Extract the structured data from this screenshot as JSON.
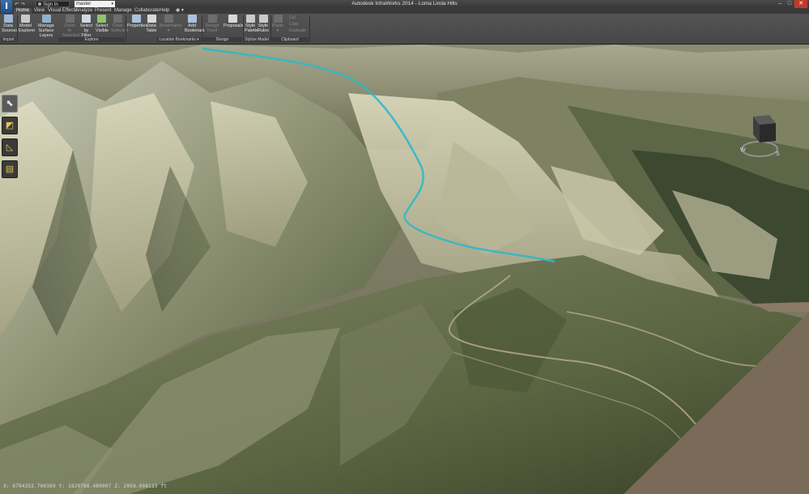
{
  "app": {
    "logo_letter": "I",
    "window_title": "Autodesk InfraWorks 2014 - Loma Linda Hills",
    "signin_label": "Sign In",
    "proposal_value": "master",
    "window_controls": [
      "–",
      "□",
      "✕"
    ]
  },
  "quick_access": {
    "undo_icon": "undo-icon",
    "redo_icon": "redo-icon"
  },
  "tabs": [
    "Home",
    "View",
    "Visual Effects",
    "Analyze",
    "Present",
    "Manage",
    "Collaborate",
    "Help"
  ],
  "tabs_overflow": "◉ ▾",
  "ribbon": {
    "buttons": [
      {
        "id": "data-sources",
        "label": "Data\nSources",
        "icon": "database-icon",
        "color": "#9fb8d6",
        "enabled": true
      },
      {
        "id": "model-explorer",
        "label": "Model\nExplorer",
        "icon": "tree-icon",
        "color": "#c9c9c9",
        "enabled": true
      },
      {
        "id": "manage-surface-layers",
        "label": "Manage\nSurface Layers",
        "icon": "layers-icon",
        "color": "#8fb0d0",
        "enabled": true
      },
      {
        "id": "zoom-to-selected",
        "label": "Zoom to\nSelected",
        "icon": "zoom-icon",
        "color": "#6d6d6d",
        "enabled": false
      },
      {
        "id": "select-by-filter",
        "label": "Select by\nFilter",
        "icon": "filter-icon",
        "color": "#cfd8e2",
        "enabled": true
      },
      {
        "id": "select-visible",
        "label": "Select\nVisible",
        "icon": "select-icon",
        "color": "#8cc46a",
        "enabled": true
      },
      {
        "id": "clear-selected",
        "label": "Clear\nSelected",
        "icon": "clear-icon",
        "color": "#6d6d6d",
        "enabled": false
      },
      {
        "id": "properties",
        "label": "Properties",
        "icon": "properties-icon",
        "color": "#a9c2dd",
        "enabled": true
      },
      {
        "id": "data-table",
        "label": "Data\nTable",
        "icon": "table-icon",
        "color": "#d8d8d8",
        "enabled": true
      },
      {
        "id": "bookmarks",
        "label": "Bookmarks\n▾",
        "icon": "bookmark-list-icon",
        "color": "#6d6d6d",
        "enabled": false
      },
      {
        "id": "add-bookmark",
        "label": "Add\nBookmark",
        "icon": "bookmark-icon",
        "color": "#a9c2dd",
        "enabled": true
      },
      {
        "id": "design-feed",
        "label": "Design Feed",
        "icon": "feed-icon",
        "color": "#6d6d6d",
        "enabled": false
      },
      {
        "id": "proposals",
        "label": "Proposals",
        "icon": "proposals-icon",
        "color": "#d8d8d8",
        "enabled": true
      },
      {
        "id": "style-palette",
        "label": "Style\nPalette",
        "icon": "palette-icon",
        "color": "#c9c9c9",
        "enabled": true
      },
      {
        "id": "style-rules",
        "label": "Style\nRules",
        "icon": "rules-icon",
        "color": "#c9c9c9",
        "enabled": true
      },
      {
        "id": "paste",
        "label": "Paste\n▾",
        "icon": "paste-icon",
        "color": "#6d6d6d",
        "enabled": false
      }
    ],
    "clipboard_small": [
      "Cut",
      "Copy",
      "Duplicate"
    ],
    "panels": [
      "Import",
      "Explore",
      "Location Bookmarks ▾",
      "Design",
      "Stylize Model",
      "Clipboard"
    ]
  },
  "left_tools": [
    {
      "id": "select-tool",
      "icon": "select-cursor-icon",
      "glyph": "⬉",
      "selected": true
    },
    {
      "id": "measure-tool",
      "icon": "ruler-icon",
      "glyph": "◩",
      "selected": false
    },
    {
      "id": "angle-tool",
      "icon": "triangle-ruler-icon",
      "glyph": "◺",
      "selected": false
    },
    {
      "id": "calendar-tool",
      "icon": "calendar-icon",
      "glyph": "▤",
      "selected": false
    }
  ],
  "viewcube": {
    "labels": [
      "W",
      "S"
    ]
  },
  "status": {
    "coordinates": "X: 6794352.700369 Y: 1829768.489007 Z: 2058.008113 ft"
  },
  "colors": {
    "road_overlay": "#2fb8c8",
    "ribbon_bg": "#4d4d4d",
    "close_button": "#c03a2b"
  }
}
